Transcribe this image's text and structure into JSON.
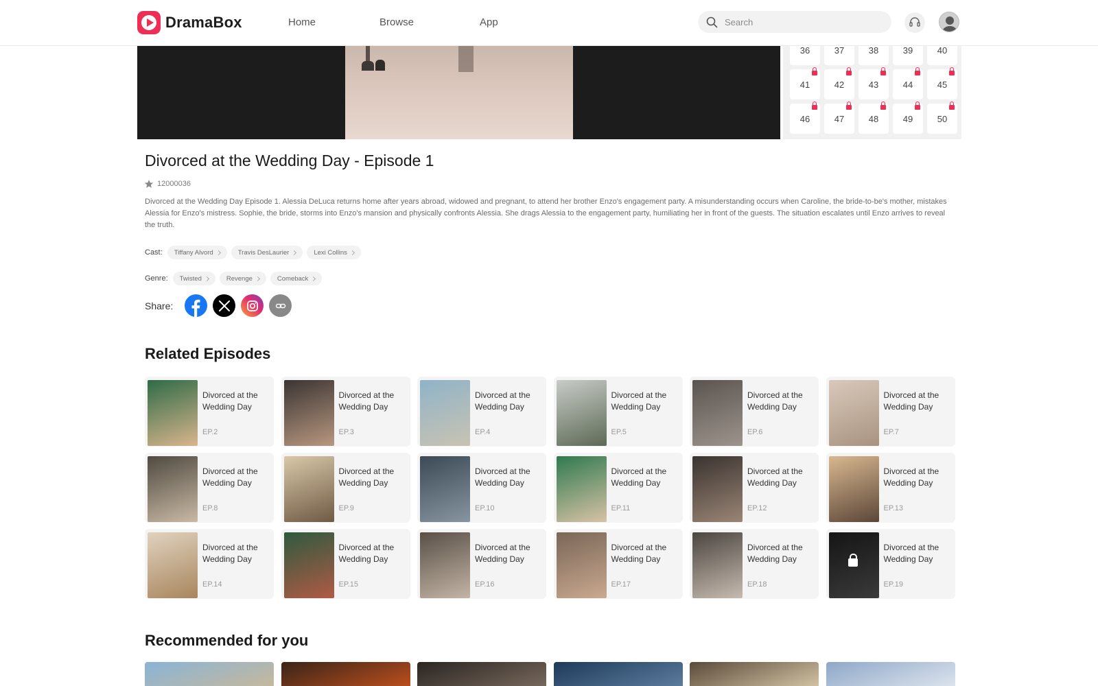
{
  "header": {
    "brand": "DramaBox",
    "nav": [
      "Home",
      "Browse",
      "App"
    ],
    "search_placeholder": "Search",
    "icons": [
      "search-icon",
      "headset-icon",
      "avatar"
    ]
  },
  "colors": {
    "brand": "#ee2e55",
    "tag_bg": "#f2f2f2",
    "card_bg": "#f4f4f4"
  },
  "episode_panel": {
    "cells": [
      {
        "n": "36",
        "locked": false
      },
      {
        "n": "37",
        "locked": false
      },
      {
        "n": "38",
        "locked": false
      },
      {
        "n": "39",
        "locked": false
      },
      {
        "n": "40",
        "locked": false
      },
      {
        "n": "41",
        "locked": true
      },
      {
        "n": "42",
        "locked": true
      },
      {
        "n": "43",
        "locked": true
      },
      {
        "n": "44",
        "locked": true
      },
      {
        "n": "45",
        "locked": true
      },
      {
        "n": "46",
        "locked": true
      },
      {
        "n": "47",
        "locked": true
      },
      {
        "n": "48",
        "locked": true
      },
      {
        "n": "49",
        "locked": true
      },
      {
        "n": "50",
        "locked": true
      }
    ]
  },
  "info": {
    "title": "Divorced at the Wedding Day - Episode 1",
    "rating": "12000036",
    "description": "Divorced at the Wedding Day Episode 1. Alessia DeLuca returns home after years abroad, widowed and pregnant, to attend her brother Enzo's engagement party. A misunderstanding occurs when Caroline, the bride-to-be's mother, mistakes Alessia for Enzo's mistress. Sophie, the bride, storms into Enzo's mansion and physically confronts Alessia. She drags Alessia to the engagement party, humiliating her in front of the guests. The situation escalates until Enzo arrives to reveal the truth.",
    "cast_label": "Cast:",
    "cast": [
      "Tiffany Alvord",
      "Travis DesLaurier",
      "Lexi Collins"
    ],
    "genre_label": "Genre:",
    "genres": [
      "Twisted",
      "Revenge",
      "Comeback"
    ],
    "share_label": "Share:",
    "share": [
      "facebook-icon",
      "x-icon",
      "instagram-icon",
      "link-icon"
    ]
  },
  "related": {
    "title": "Related Episodes",
    "items": [
      {
        "name": "Divorced at the Wedding Day",
        "ep": "EP.2",
        "thumb": [
          "#2f6b47",
          "#d9b58d"
        ]
      },
      {
        "name": "Divorced at the Wedding Day",
        "ep": "EP.3",
        "thumb": [
          "#3b3533",
          "#b89780"
        ]
      },
      {
        "name": "Divorced at the Wedding Day",
        "ep": "EP.4",
        "thumb": [
          "#8fb3c8",
          "#c9c3b2"
        ]
      },
      {
        "name": "Divorced at the Wedding Day",
        "ep": "EP.5",
        "thumb": [
          "#c8ccc8",
          "#5d6a55"
        ]
      },
      {
        "name": "Divorced at the Wedding Day",
        "ep": "EP.6",
        "thumb": [
          "#5a5450",
          "#9d948c"
        ]
      },
      {
        "name": "Divorced at the Wedding Day",
        "ep": "EP.7",
        "thumb": [
          "#d9c9bc",
          "#a8937f"
        ]
      },
      {
        "name": "Divorced at the Wedding Day",
        "ep": "EP.8",
        "thumb": [
          "#4f4a40",
          "#c9b9a5"
        ]
      },
      {
        "name": "Divorced at the Wedding Day",
        "ep": "EP.9",
        "thumb": [
          "#d8c8a8",
          "#6f5a45"
        ]
      },
      {
        "name": "Divorced at the Wedding Day",
        "ep": "EP.10",
        "thumb": [
          "#3c4a55",
          "#8795a0"
        ]
      },
      {
        "name": "Divorced at the Wedding Day",
        "ep": "EP.11",
        "thumb": [
          "#2f7a50",
          "#d8c2a5"
        ]
      },
      {
        "name": "Divorced at the Wedding Day",
        "ep": "EP.12",
        "thumb": [
          "#3a3330",
          "#9a8575"
        ]
      },
      {
        "name": "Divorced at the Wedding Day",
        "ep": "EP.13",
        "thumb": [
          "#d9b890",
          "#5b4638"
        ]
      },
      {
        "name": "Divorced at the Wedding Day",
        "ep": "EP.14",
        "thumb": [
          "#e0d2bf",
          "#a8865d"
        ]
      },
      {
        "name": "Divorced at the Wedding Day",
        "ep": "EP.15",
        "thumb": [
          "#2e5a3e",
          "#b05a45"
        ]
      },
      {
        "name": "Divorced at the Wedding Day",
        "ep": "EP.16",
        "thumb": [
          "#5a5048",
          "#c3b5a5"
        ]
      },
      {
        "name": "Divorced at the Wedding Day",
        "ep": "EP.17",
        "thumb": [
          "#7a6658",
          "#caa98f"
        ]
      },
      {
        "name": "Divorced at the Wedding Day",
        "ep": "EP.18",
        "thumb": [
          "#4b4540",
          "#c7bbb0"
        ]
      },
      {
        "name": "Divorced at the Wedding Day",
        "ep": "EP.19",
        "thumb": [
          "#151515",
          "#3a3a3a"
        ],
        "locked": true
      }
    ]
  },
  "recommended": {
    "title": "Recommended for you",
    "items": [
      {
        "thumb": [
          "#8ab4d6",
          "#c8b89a"
        ]
      },
      {
        "thumb": [
          "#3a2418",
          "#c0501e"
        ]
      },
      {
        "thumb": [
          "#2a2522",
          "#7a6a5e"
        ]
      },
      {
        "thumb": [
          "#1e3a5a",
          "#5f7fa0"
        ]
      },
      {
        "thumb": [
          "#5a4a3a",
          "#d8c8a8"
        ]
      },
      {
        "thumb": [
          "#8fa8c8",
          "#dfe6ef"
        ]
      }
    ]
  }
}
